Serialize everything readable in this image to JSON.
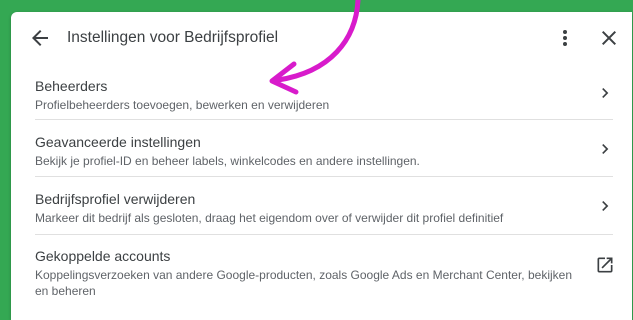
{
  "header": {
    "title": "Instellingen voor Bedrijfsprofiel"
  },
  "rows": [
    {
      "name": "Beheerders",
      "desc": "Profielbeheerders toevoegen, bewerken en verwijderen"
    },
    {
      "name": "Geavanceerde instellingen",
      "desc": "Bekijk je profiel-ID en beheer labels, winkelcodes en andere instellingen."
    },
    {
      "name": "Bedrijfsprofiel verwijderen",
      "desc": "Markeer dit bedrijf als gesloten, draag het eigendom over of verwijder dit profiel definitief"
    },
    {
      "name": "Gekoppelde accounts",
      "desc": "Koppelingsverzoeken van andere Google-producten, zoals Google Ads en Merchant Center, bekijken en beheren"
    }
  ],
  "colors": {
    "background": "#34a853",
    "annotation_arrow": "#d81bcb"
  }
}
